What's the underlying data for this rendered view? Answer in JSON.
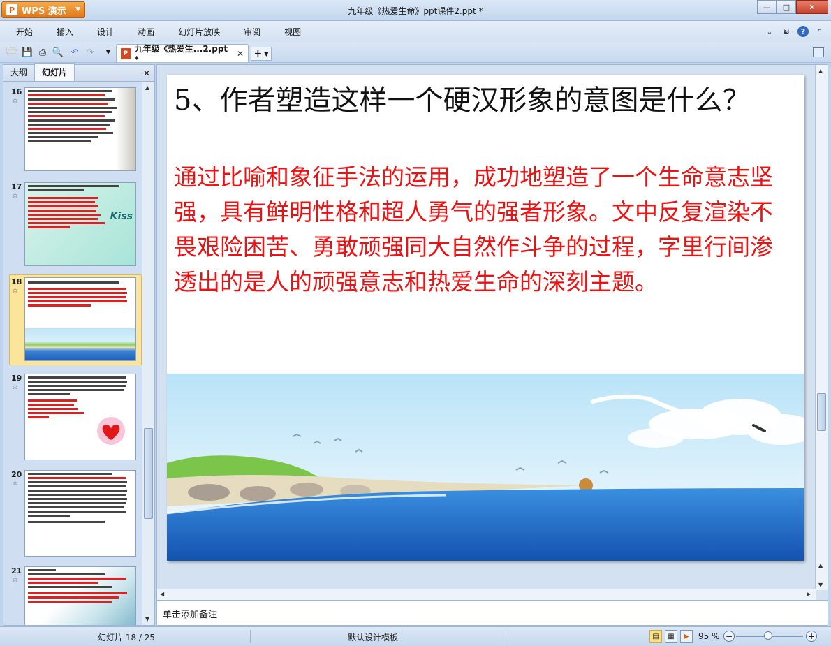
{
  "app": {
    "button_label": "WPS 演示",
    "window_title": "九年级《热爱生命》ppt课件2.ppt *"
  },
  "menu": {
    "items": [
      "开始",
      "插入",
      "设计",
      "动画",
      "幻灯片放映",
      "审阅",
      "视图"
    ]
  },
  "toolbar": {
    "doc_tab_label": "九年级《热爱生...2.ppt *"
  },
  "left_panel": {
    "tabs": [
      "大纲",
      "幻灯片"
    ],
    "selected_tab": "幻灯片",
    "slides": [
      {
        "number": "16",
        "star": "☆"
      },
      {
        "number": "17",
        "star": "☆"
      },
      {
        "number": "18",
        "star": "☆",
        "selected": true
      },
      {
        "number": "19",
        "star": "☆"
      },
      {
        "number": "20",
        "star": "☆"
      },
      {
        "number": "21",
        "star": "☆"
      }
    ],
    "thumb_text": {
      "s17_kiss": "Kiss"
    }
  },
  "slide": {
    "title": "5、作者塑造这样一个硬汉形象的意图是什么？",
    "body": "通过比喻和象征手法的运用，成功地塑造了一个生命意志坚强，具有鲜明性格和超人勇气的强者形象。文中反复渲染不畏艰险困苦、勇敢顽强同大自然作斗争的过程，字里行间渗透出的是人的顽强意志和热爱生命的深刻主题。"
  },
  "notes": {
    "placeholder": "单击添加备注"
  },
  "status": {
    "slide_counter": "幻灯片 18 / 25",
    "template": "默认设计模板",
    "zoom": "95 %"
  },
  "colors": {
    "accent": "#e0781a",
    "body_text": "#ee1111",
    "selected_thumb": "#fbe59a"
  }
}
